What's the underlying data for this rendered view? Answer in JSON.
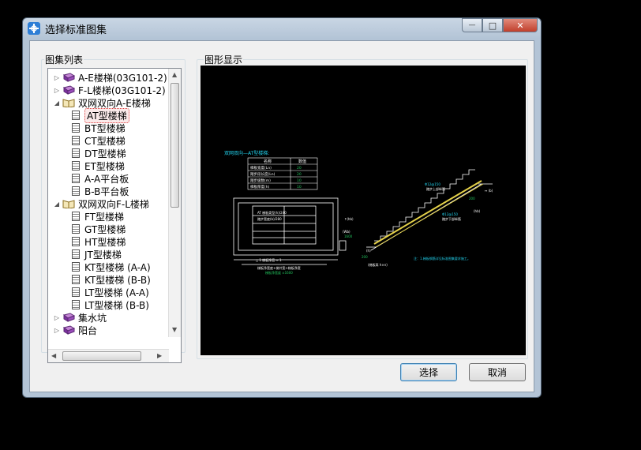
{
  "window": {
    "title": "选择标准图集",
    "controls": {
      "minimize": "—",
      "maximize": "□",
      "close": "✕"
    }
  },
  "left_panel": {
    "label": "图集列表",
    "tree": [
      {
        "label": "A-E楼梯(03G101-2)",
        "kind": "book",
        "expanded": false,
        "level": 0
      },
      {
        "label": "F-L楼梯(03G101-2)",
        "kind": "book",
        "expanded": false,
        "level": 0
      },
      {
        "label": "双网双向A-E楼梯",
        "kind": "book-open",
        "expanded": true,
        "level": 0
      },
      {
        "label": "AT型楼梯",
        "kind": "doc",
        "level": 1,
        "selected": true
      },
      {
        "label": "BT型楼梯",
        "kind": "doc",
        "level": 1
      },
      {
        "label": "CT型楼梯",
        "kind": "doc",
        "level": 1
      },
      {
        "label": "DT型楼梯",
        "kind": "doc",
        "level": 1
      },
      {
        "label": "ET型楼梯",
        "kind": "doc",
        "level": 1
      },
      {
        "label": "A-A平台板",
        "kind": "doc",
        "level": 1
      },
      {
        "label": "B-B平台板",
        "kind": "doc",
        "level": 1
      },
      {
        "label": "双网双向F-L楼梯",
        "kind": "book-open",
        "expanded": true,
        "level": 0
      },
      {
        "label": "FT型楼梯",
        "kind": "doc",
        "level": 1
      },
      {
        "label": "GT型楼梯",
        "kind": "doc",
        "level": 1
      },
      {
        "label": "HT型楼梯",
        "kind": "doc",
        "level": 1
      },
      {
        "label": "JT型楼梯",
        "kind": "doc",
        "level": 1
      },
      {
        "label": "KT型楼梯 (A-A)",
        "kind": "doc",
        "level": 1
      },
      {
        "label": "KT型楼梯 (B-B)",
        "kind": "doc",
        "level": 1
      },
      {
        "label": "LT型楼梯 (A-A)",
        "kind": "doc",
        "level": 1
      },
      {
        "label": "LT型楼梯 (B-B)",
        "kind": "doc",
        "level": 1
      },
      {
        "label": "集水坑",
        "kind": "book",
        "expanded": false,
        "level": 0
      },
      {
        "label": "阳台",
        "kind": "book",
        "expanded": false,
        "level": 0
      }
    ]
  },
  "right_panel": {
    "label": "图形显示",
    "drawing": {
      "heading": "双网双向—AT型楼梯:",
      "table_header": [
        "名称",
        "数值"
      ],
      "table_rows": [
        [
          "梯板宽度(Ln)",
          "20"
        ],
        [
          "踏步段长度(Ln)",
          "20"
        ],
        [
          "踏步级数(m)",
          "10"
        ],
        [
          "梯板厚度(h)",
          "10"
        ]
      ],
      "note": "注：1.梯板钢筋详见标准图集要求施工。",
      "colors": {
        "lines": "#ffffff",
        "labels": "#22d3ee",
        "values": "#22c55e",
        "stair": "#e5d24a"
      }
    }
  },
  "buttons": {
    "select": "选择",
    "cancel": "取消"
  }
}
